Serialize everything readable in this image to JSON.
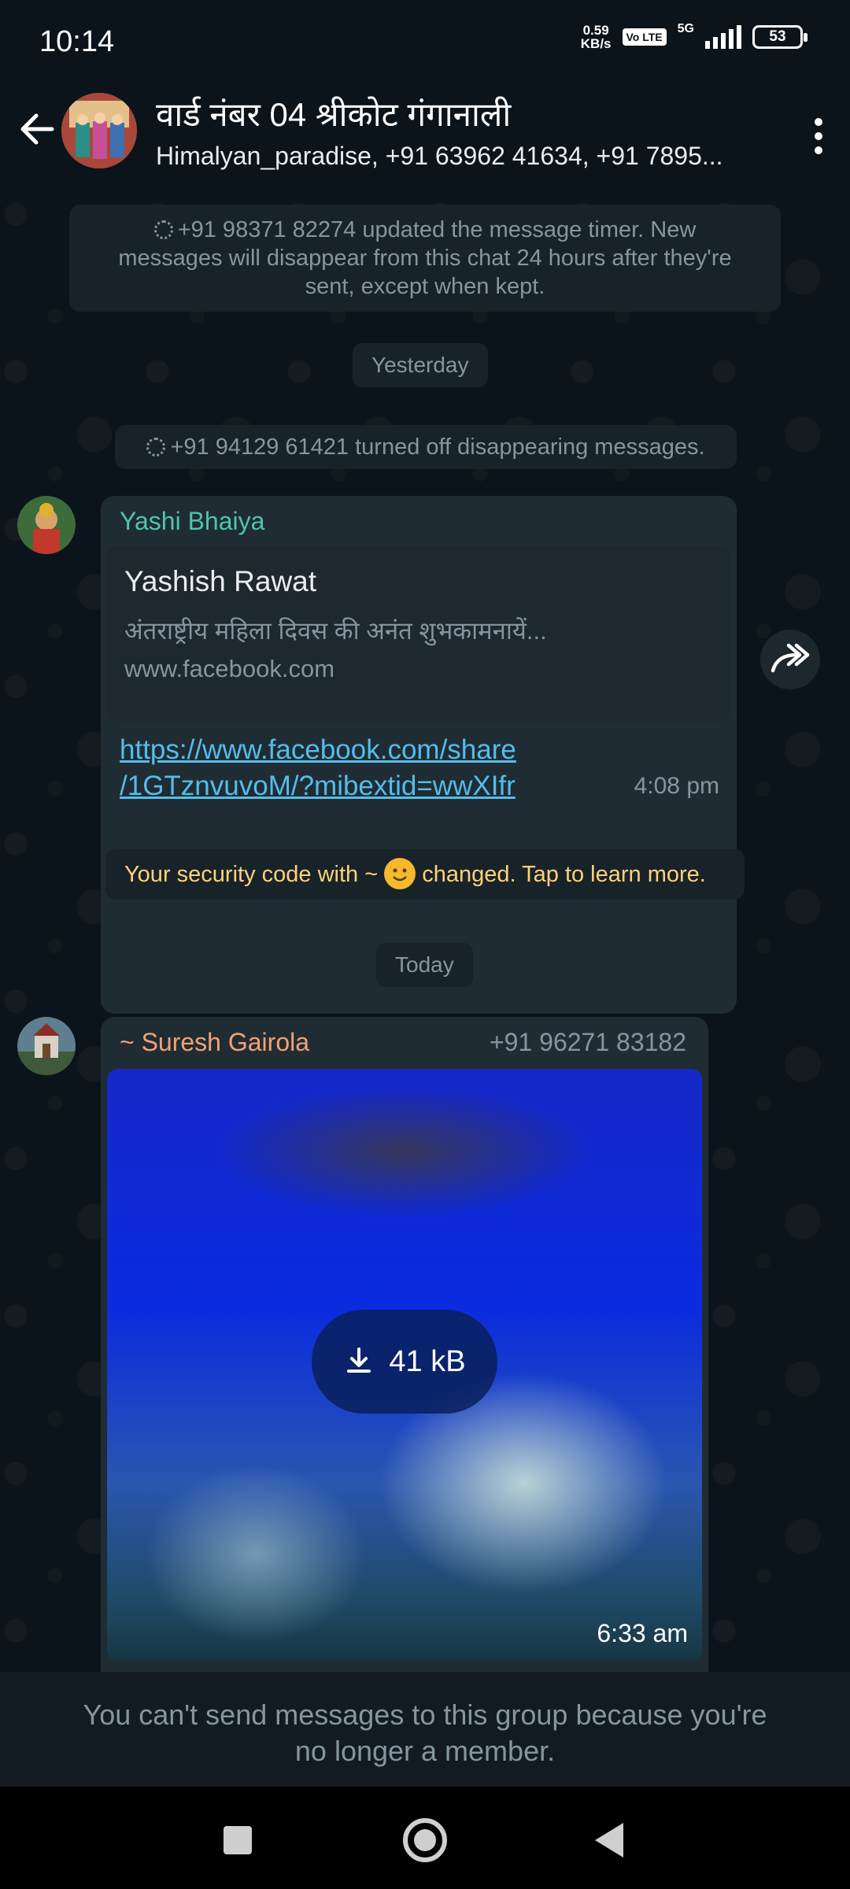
{
  "status_bar": {
    "time": "10:14",
    "net_speed": "0.59",
    "net_speed_unit": "KB/s",
    "volte": "Vo LTE",
    "network": "5G",
    "battery": "53"
  },
  "header": {
    "title": "वार्ड नंबर 04 श्रीकोट गंगानाली",
    "subtitle": "Himalyan_paradise, +91 63962 41634, +91 7895..."
  },
  "messages": {
    "timer_notice": "+91 98371 82274 updated the message timer. New messages will disappear from this chat 24 hours after they're sent, except when kept.",
    "date_yesterday": "Yesterday",
    "disappearing_off": "+91 94129 61421 turned off disappearing messages.",
    "msg1": {
      "sender": "Yashi Bhaiya",
      "sender_color": "#4fc4b0",
      "preview_title": "Yashish Rawat",
      "preview_desc": "अंतराष्ट्रीय महिला दिवस की अनंत शुभकामनायें...",
      "preview_domain": "www.facebook.com",
      "link_line1": "https://www.facebook.com/share",
      "link_line2": "/1GTznvuvoM/?mibextid=wwXIfr",
      "time": "4:08 pm"
    },
    "security_pre": "Your security code with ~",
    "security_post": "changed. Tap to learn more.",
    "date_today": "Today",
    "msg2": {
      "sender": "~ Suresh Gairola",
      "sender_color": "#f4a274",
      "phone": "+91 96271 83182",
      "download_size": "41 kB",
      "time": "6:33 am"
    }
  },
  "footer": {
    "notice_line1": "You can't send messages to this group because you're",
    "notice_line2": "no longer a member."
  }
}
